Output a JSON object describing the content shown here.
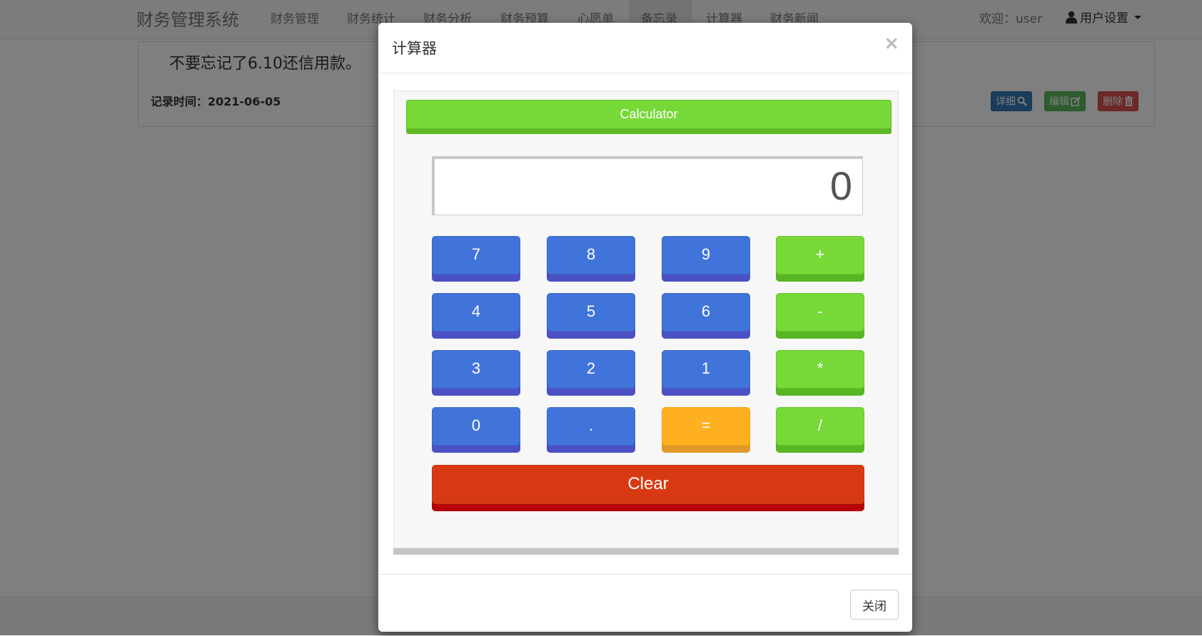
{
  "navbar": {
    "brand": "财务管理系统",
    "items": [
      {
        "label": "财务管理"
      },
      {
        "label": "财务统计"
      },
      {
        "label": "财务分析"
      },
      {
        "label": "财务预算"
      },
      {
        "label": "心愿单"
      },
      {
        "label": "备忘录"
      },
      {
        "label": "计算器"
      },
      {
        "label": "财务新闻"
      }
    ],
    "welcome": "欢迎：user",
    "user_settings": "用户设置"
  },
  "memo": {
    "text": "不要忘记了6.10还信用款。",
    "time": "记录时间：2021-06-05",
    "detail_label": "详细",
    "edit_label": "编辑",
    "delete_label": "删除"
  },
  "modal": {
    "title": "计算器",
    "close_symbol": "×",
    "footer_close_label": "关闭"
  },
  "calculator": {
    "banner": "Calculator",
    "display": "0",
    "keys": {
      "k7": "7",
      "k8": "8",
      "k9": "9",
      "plus": "+",
      "k4": "4",
      "k5": "5",
      "k6": "6",
      "minus": "-",
      "k3": "3",
      "k2": "2",
      "k1": "1",
      "multiply": "*",
      "k0": "0",
      "dot": ".",
      "equals": "=",
      "divide": "/"
    },
    "clear": "Clear"
  },
  "colors": {
    "number_key": "#4174da",
    "operator_key": "#77d937",
    "equals_key": "#ffb020",
    "clear_key": "#d73a12"
  }
}
